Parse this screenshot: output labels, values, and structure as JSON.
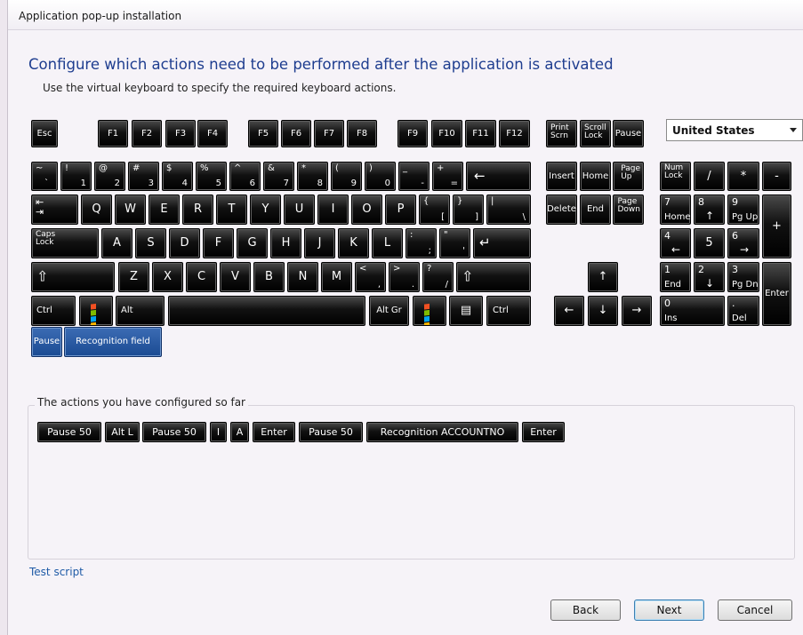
{
  "window": {
    "title": "Application pop-up installation"
  },
  "heading": "Configure which actions need to be performed after the application is activated",
  "subheading": "Use the virtual keyboard to specify the required keyboard actions.",
  "layout_select": {
    "value": "United States"
  },
  "keys": {
    "esc": "Esc",
    "f1": "F1",
    "f2": "F2",
    "f3": "F3",
    "f4": "F4",
    "f5": "F5",
    "f6": "F6",
    "f7": "F7",
    "f8": "F8",
    "f9": "F9",
    "f10": "F10",
    "f11": "F11",
    "f12": "F12",
    "print_scrn": "Print\nScrn",
    "scroll_lock": "Scroll\nLock",
    "pause_top": "Pause",
    "tilde_up": "~",
    "tilde_low": "`",
    "n1_up": "!",
    "n1": "1",
    "n2_up": "@",
    "n2": "2",
    "n3_up": "#",
    "n3": "3",
    "n4_up": "$",
    "n4": "4",
    "n5_up": "%",
    "n5": "5",
    "n6_up": "^",
    "n6": "6",
    "n7_up": "&",
    "n7": "7",
    "n8_up": "*",
    "n8": "8",
    "n9_up": "(",
    "n9": "9",
    "n0_up": ")",
    "n0": "0",
    "minus_up": "_",
    "minus": "-",
    "equal_up": "+",
    "equal": "=",
    "backspace": "←",
    "insert": "Insert",
    "home": "Home",
    "page_up": "Page\nUp",
    "delete": "Delete",
    "end": "End",
    "page_down": "Page\nDown",
    "num_lock": "Num\nLock",
    "np_div": "/",
    "np_mul": "*",
    "np_minus": "-",
    "tab": "⇤\n⇥",
    "q": "Q",
    "w": "W",
    "e": "E",
    "r": "R",
    "t": "T",
    "y": "Y",
    "u": "U",
    "i": "I",
    "o": "O",
    "p": "P",
    "lbrace_up": "{",
    "lbrace": "[",
    "rbrace_up": "}",
    "rbrace": "]",
    "pipe_up": "|",
    "backslash": "\\",
    "np7_up": "7",
    "np7": "Home",
    "np8_up": "8",
    "np8": "↑",
    "np9_up": "9",
    "np9": "Pg Up",
    "np_plus": "+",
    "caps": "Caps\nLock",
    "a": "A",
    "s": "S",
    "d": "D",
    "f": "F",
    "g": "G",
    "h": "H",
    "j": "J",
    "k": "K",
    "l": "L",
    "colon_up": ":",
    "colon": ";",
    "quote_up": "\"",
    "quote": "'",
    "enter": "↵",
    "np4_up": "4",
    "np4": "←",
    "np5": "5",
    "np6_up": "6",
    "np6": "→",
    "lshift": "⇧",
    "z": "Z",
    "x": "X",
    "c": "C",
    "v": "V",
    "b": "B",
    "n": "N",
    "m": "M",
    "lt_up": "<",
    "lt": ",",
    "gt_up": ">",
    "gt": ".",
    "q_up": "?",
    "slash": "/",
    "rshift": "⇧",
    "arrow_up": "↑",
    "np1_up": "1",
    "np1": "End",
    "np2_up": "2",
    "np2": "↓",
    "np3_up": "3",
    "np3": "Pg Dn",
    "np_enter": "Enter",
    "lctrl": "Ctrl",
    "lalt": "Alt",
    "altgr": "Alt Gr",
    "rctrl": "Ctrl",
    "menu": "▤",
    "arrow_left": "←",
    "arrow_down": "↓",
    "arrow_right": "→",
    "np0_up": "0",
    "np0": "Ins",
    "npdot_up": ".",
    "npdot": "Del",
    "pause_special": "Pause",
    "recognition": "Recognition field"
  },
  "actions_group": {
    "label": "The actions you have configured so far",
    "items": [
      "Pause 50",
      "Alt L",
      "Pause 50",
      "I",
      "A",
      "Enter",
      "Pause 50",
      "Recognition ACCOUNTNO",
      "Enter"
    ]
  },
  "test_script": "Test script",
  "buttons": {
    "back": "Back",
    "next": "Next",
    "cancel": "Cancel"
  },
  "colors": {
    "heading": "#1e3d8f",
    "link": "#1e5aa6",
    "key": "#000000",
    "special_key": "#1a4a92"
  }
}
